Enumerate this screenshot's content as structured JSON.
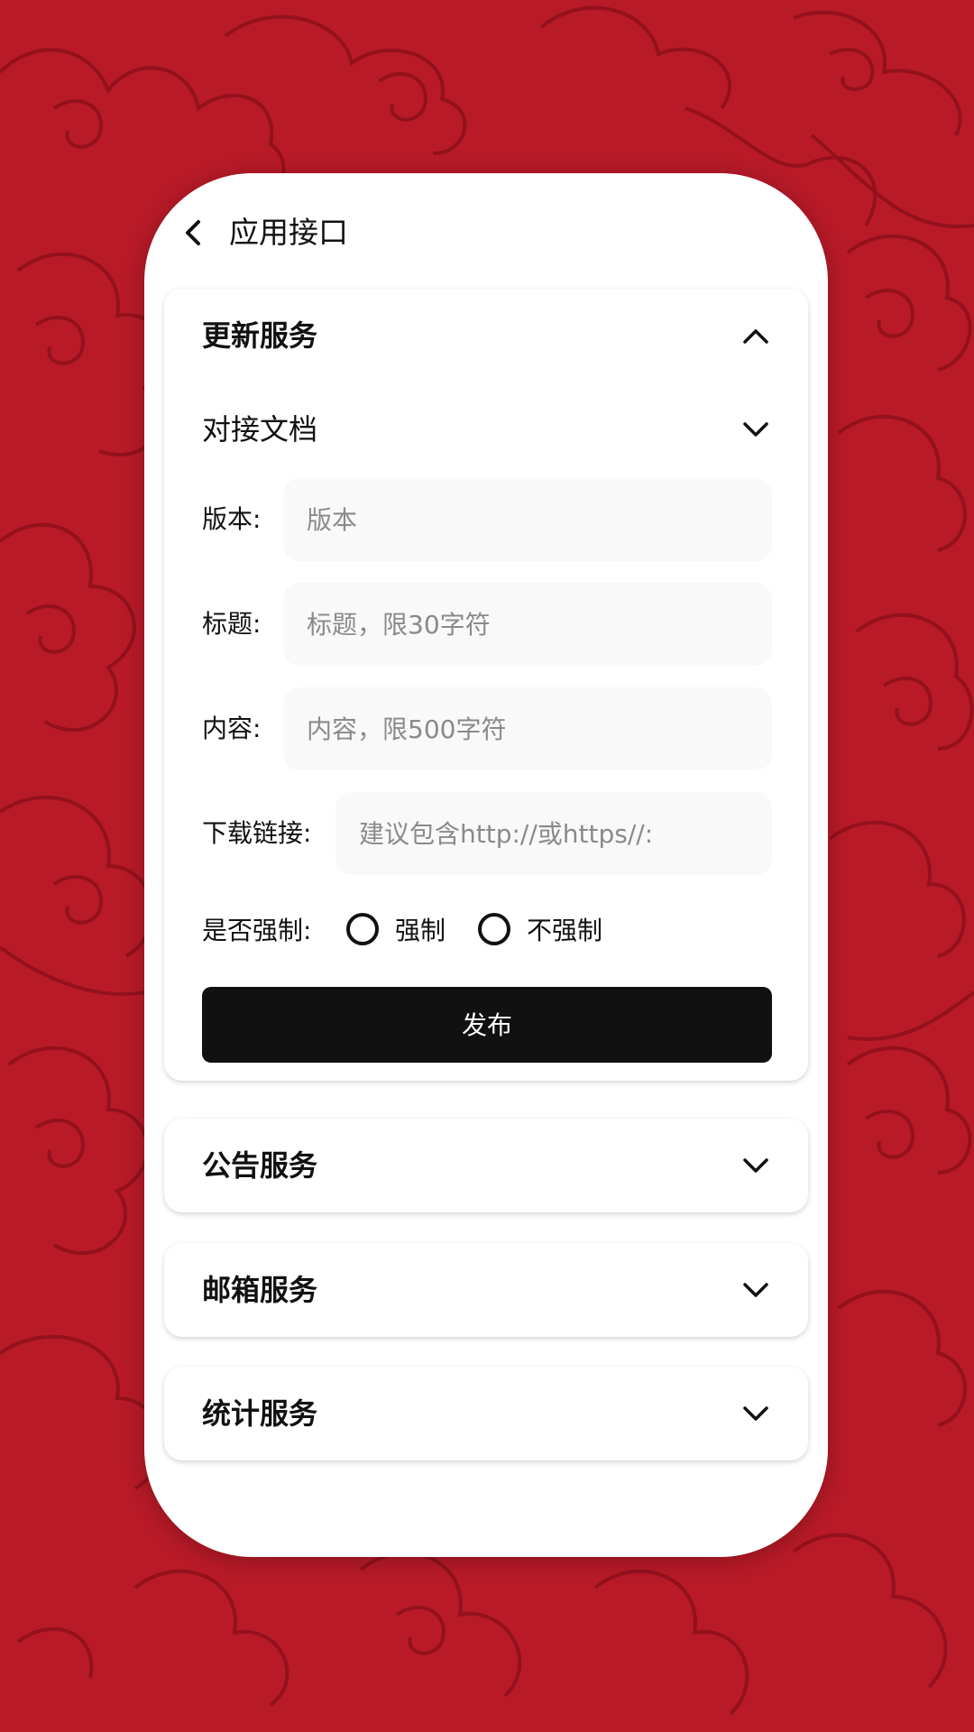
{
  "colors": {
    "background": "#b81a28",
    "pattern_stroke": "#8a0f1a",
    "card": "#ffffff",
    "input_bg": "#f9f9f9",
    "primary_button": "#111111"
  },
  "header": {
    "back_icon": "chevron-left-icon",
    "title": "应用接口"
  },
  "update_service": {
    "title": "更新服务",
    "expanded": true,
    "doc_label": "对接文档",
    "fields": {
      "version": {
        "label": "版本:",
        "placeholder": "版本"
      },
      "title": {
        "label": "标题:",
        "placeholder": "标题，限30字符"
      },
      "content": {
        "label": "内容:",
        "placeholder": "内容，限500字符"
      },
      "download": {
        "label": "下载链接:",
        "placeholder": "建议包含http://或https//:"
      }
    },
    "force": {
      "label": "是否强制:",
      "options": [
        "强制",
        "不强制"
      ]
    },
    "publish_label": "发布"
  },
  "services": {
    "notice": "公告服务",
    "mail": "邮箱服务",
    "stats": "统计服务"
  }
}
